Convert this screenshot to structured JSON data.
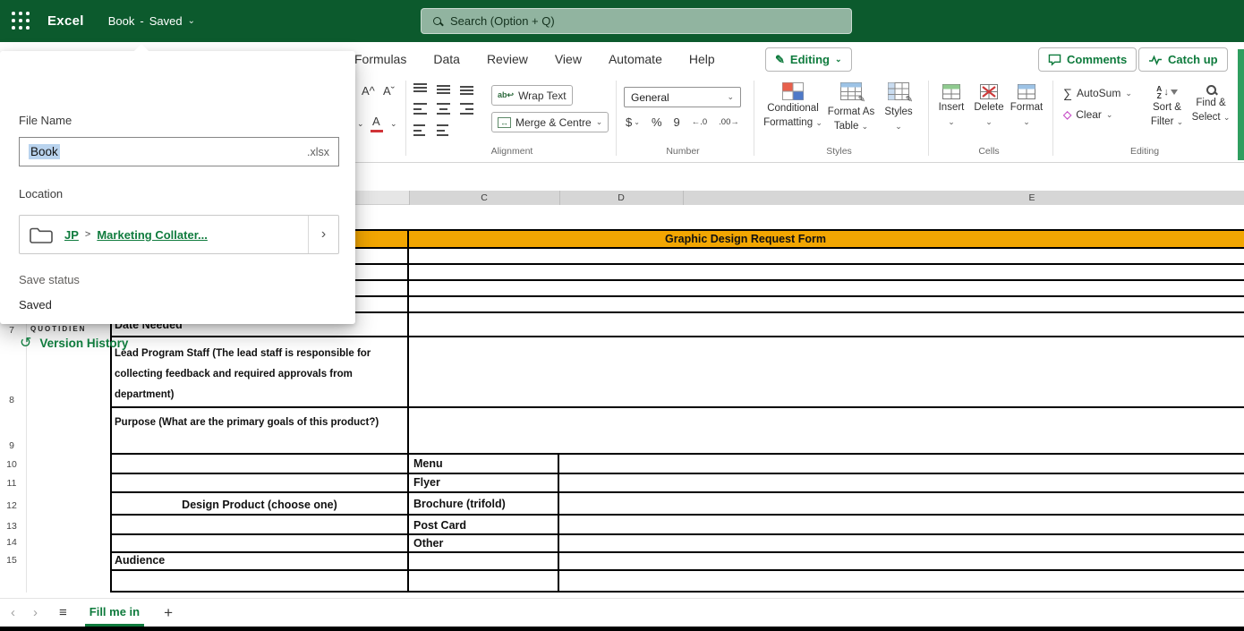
{
  "colors": {
    "brand_green": "#0f7b3d",
    "topbar_green": "#0c5a2d",
    "title_row_orange": "#f2a602",
    "filename_selection_blue": "#b9d3ee",
    "font_color_red": "#d13438",
    "clear_icon_pink": "#c84fc8"
  },
  "topbar": {
    "app_name": "Excel",
    "doc_name": "Book",
    "separator": "-",
    "doc_status": "Saved",
    "search_placeholder": "Search (Option + Q)"
  },
  "file_panel": {
    "file_name_label": "File Name",
    "file_name_value": "Book",
    "file_extension": ".xlsx",
    "location_label": "Location",
    "breadcrumb_root": "JP",
    "breadcrumb_separator": ">",
    "breadcrumb_folder": "Marketing Collater...",
    "save_status_label": "Save status",
    "save_status_value": "Saved",
    "version_history_label": "Version History"
  },
  "ribbon": {
    "tabs": [
      "Formulas",
      "Data",
      "Review",
      "View",
      "Automate",
      "Help"
    ],
    "editing_label": "Editing",
    "comments_label": "Comments",
    "catch_up_label": "Catch up",
    "wrap_text_label": "Wrap Text",
    "merge_centre_label": "Merge & Centre",
    "number_format_value": "General",
    "conditional_line1": "Conditional",
    "conditional_line2": "Formatting",
    "format_table_line1": "Format As",
    "format_table_line2": "Table",
    "styles_button_label": "Styles",
    "insert_label": "Insert",
    "delete_label": "Delete",
    "format_label": "Format",
    "autosum_label": "AutoSum",
    "clear_label": "Clear",
    "sort_line1": "Sort &",
    "sort_line2": "Filter",
    "find_line1": "Find &",
    "find_line2": "Select",
    "group_labels": {
      "alignment": "Alignment",
      "number": "Number",
      "styles": "Styles",
      "cells": "Cells",
      "editing": "Editing"
    }
  },
  "grid": {
    "column_headers": [
      "C",
      "D",
      "E"
    ],
    "row_numbers": [
      "7",
      "8",
      "9",
      "10",
      "11",
      "12",
      "13",
      "14",
      "15"
    ],
    "logo_text": "QUOTIDIEN",
    "form_title": "Graphic Design Request Form",
    "label_date_needed": "Date Needed",
    "label_lead_staff": "Lead Program Staff (The lead staff is responsible for collecting feedback and required approvals from department)",
    "label_purpose": "Purpose (What are the primary goals of this product?)",
    "label_design_product": "Design Product (choose one)",
    "options": [
      "Menu",
      "Flyer",
      "Brochure (trifold)",
      "Post Card",
      "Other"
    ],
    "label_audience": "Audience"
  },
  "sheet_bar": {
    "active_sheet": "Fill me in"
  },
  "icons": {
    "chevron_down": "⌄",
    "chevron_right": "›",
    "nav_left": "‹",
    "nav_right": "›",
    "menu": "≡",
    "add_sheet": "+",
    "history": "↺",
    "pencil": "✎",
    "sigma": "∑",
    "eraser": "◇",
    "wrap_ab": "ab",
    "wrap_arrow": "↩",
    "merge_arrows": "↔",
    "currency": "$",
    "percent": "%",
    "comma_style": "9",
    "increase_decimal": "←.0",
    "decrease_decimal": ".00→",
    "font_increase": "A^",
    "font_decrease": "Aˇ",
    "font_color_letter": "A",
    "sort_a": "A",
    "sort_z": "Z",
    "sort_arrow": "↓"
  }
}
